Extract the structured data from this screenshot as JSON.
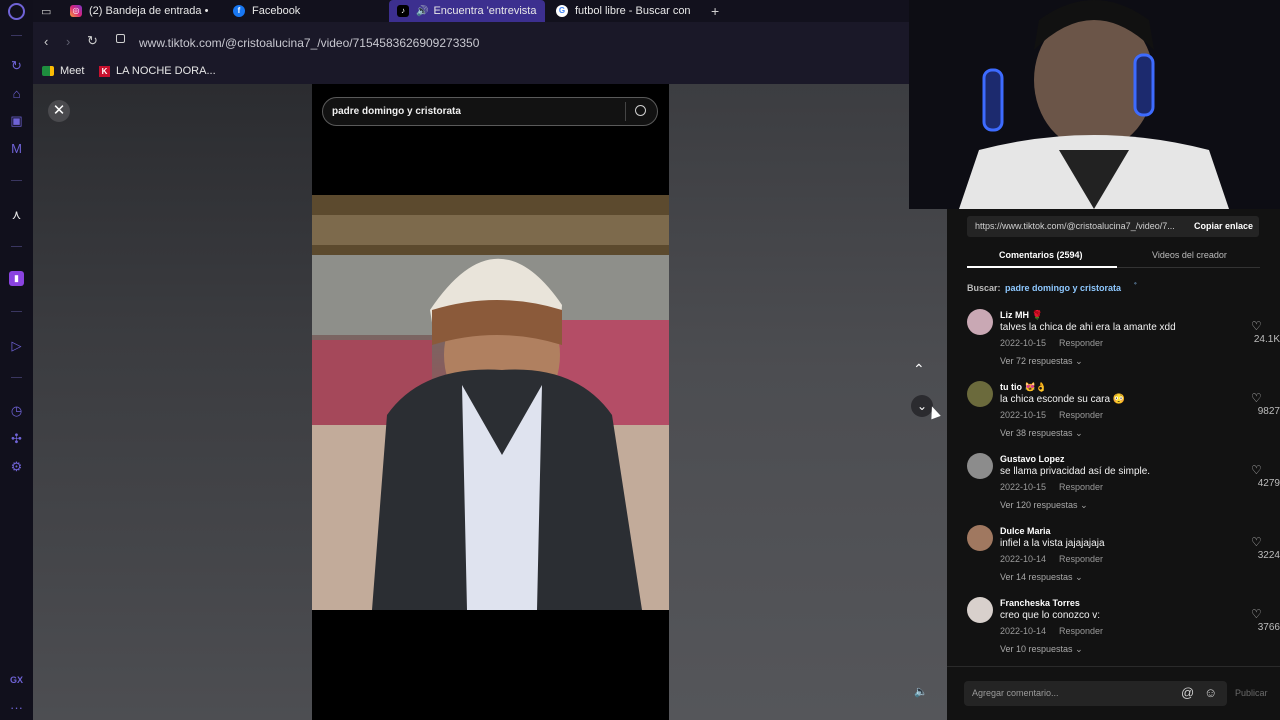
{
  "browser": {
    "tabs": [
      {
        "label": "(2) Bandeja de entrada •",
        "icon": "instagram-icon"
      },
      {
        "label": "Facebook",
        "icon": "facebook-icon"
      },
      {
        "label": "Encuentra 'entrevista",
        "icon": "tiktok-icon",
        "active": true
      },
      {
        "label": "futbol libre - Buscar con",
        "icon": "google-icon"
      }
    ],
    "url": "www.tiktok.com/@cristoalucina7_/video/7154583626909273350",
    "bookmarks": [
      {
        "label": "Meet"
      },
      {
        "label": "LA NOCHE DORA..."
      }
    ],
    "sidebar_label": "GX",
    "accent_color": "#6f63d6"
  },
  "player": {
    "search_value": "padre domingo y cristorata"
  },
  "panel": {
    "link": "https://www.tiktok.com/@cristoalucina7_/video/7...",
    "copy_label": "Copiar enlace",
    "tab_comments": "Comentarios (2594)",
    "tab_creator": "Videos del creador",
    "search_label": "Buscar:",
    "search_query": "padre domingo y cristorata",
    "comments": [
      {
        "user": "Liz MH 🌹",
        "text": "talves la chica de ahi era la amante xdd",
        "date": "2022-10-15",
        "reply": "Responder",
        "more": "Ver 72 respuestas",
        "likes": "24.1K"
      },
      {
        "user": "tu tio 😻👌",
        "text": "la chica esconde su cara 😳",
        "date": "2022-10-15",
        "reply": "Responder",
        "more": "Ver 38 respuestas",
        "likes": "9827"
      },
      {
        "user": "Gustavo Lopez",
        "text": "se llama privacidad así de simple.",
        "date": "2022-10-15",
        "reply": "Responder",
        "more": "Ver 120 respuestas",
        "likes": "4279"
      },
      {
        "user": "Dulce Maria",
        "text": "infiel a la vista jajajajaja",
        "date": "2022-10-14",
        "reply": "Responder",
        "more": "Ver 14 respuestas",
        "likes": "3224"
      },
      {
        "user": "Francheska Torres",
        "text": "creo que lo conozco v:",
        "date": "2022-10-14",
        "reply": "Responder",
        "more": "Ver 10 respuestas",
        "likes": "3766"
      }
    ],
    "comment_placeholder": "Agregar comentario...",
    "publish_label": "Publicar"
  }
}
